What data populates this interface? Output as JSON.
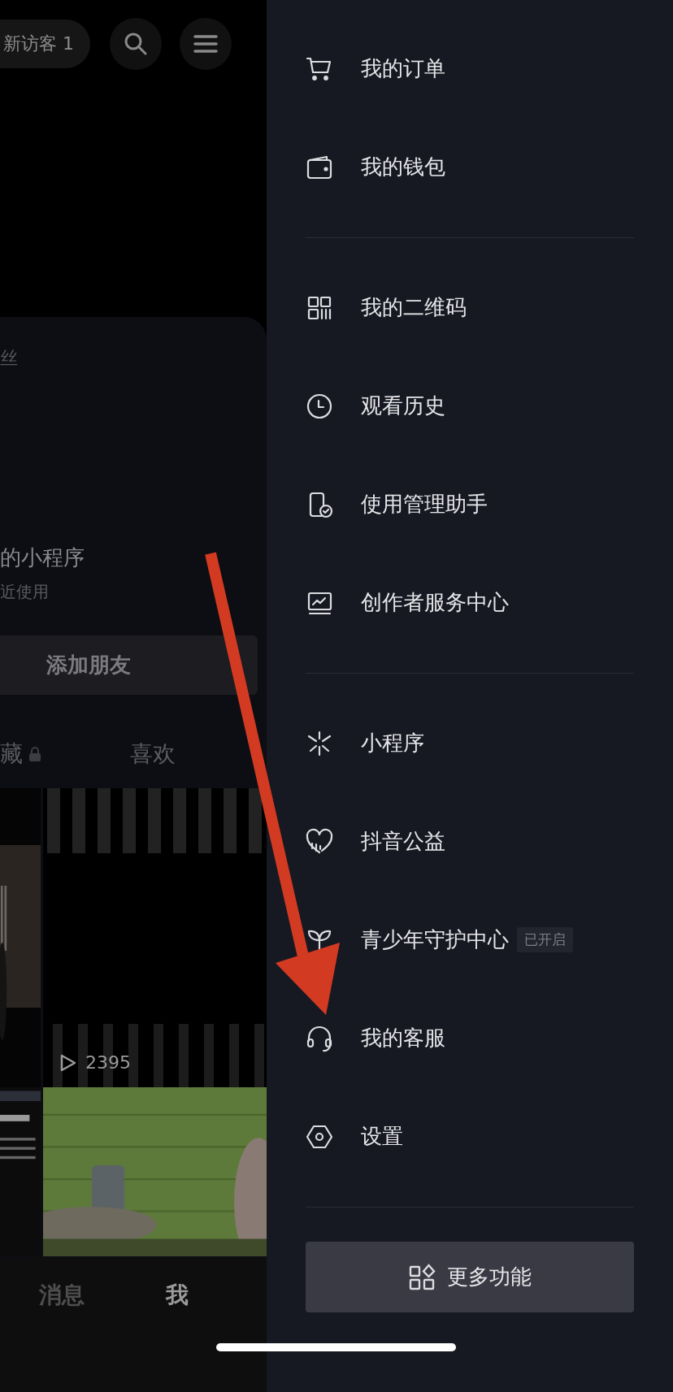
{
  "profile_header": {
    "visitor_badge": "新访客 1"
  },
  "profile_card": {
    "followers_label": "丝",
    "mini_programs_title": "的小程序",
    "mini_programs_subtitle": "近使用",
    "add_friend_button": "添加朋友"
  },
  "content_tabs": [
    {
      "label": "藏",
      "locked": true,
      "selected": false
    },
    {
      "label": "喜欢",
      "locked": false,
      "selected": false
    }
  ],
  "videos": [
    {
      "kind": "room"
    },
    {
      "kind": "stripes",
      "play_count": "2395"
    },
    {
      "kind": "poster"
    },
    {
      "kind": "wall"
    }
  ],
  "bottom_nav": [
    {
      "label": "消息",
      "selected": false
    },
    {
      "label": "我",
      "selected": true
    }
  ],
  "drawer": {
    "sections": [
      [
        {
          "kind": "cart",
          "label": "我的订单"
        },
        {
          "kind": "wallet",
          "label": "我的钱包"
        }
      ],
      [
        {
          "kind": "qr",
          "label": "我的二维码"
        },
        {
          "kind": "clock",
          "label": "观看历史"
        },
        {
          "kind": "phone",
          "label": "使用管理助手"
        },
        {
          "kind": "monitor",
          "label": "创作者服务中心"
        }
      ],
      [
        {
          "kind": "spark",
          "label": "小程序"
        },
        {
          "kind": "heart",
          "label": "抖音公益"
        },
        {
          "kind": "sprout",
          "label": "青少年守护中心",
          "badge": "已开启"
        },
        {
          "kind": "headset",
          "label": "我的客服"
        },
        {
          "kind": "hexagon",
          "label": "设置"
        }
      ]
    ],
    "more_button": "更多功能"
  }
}
